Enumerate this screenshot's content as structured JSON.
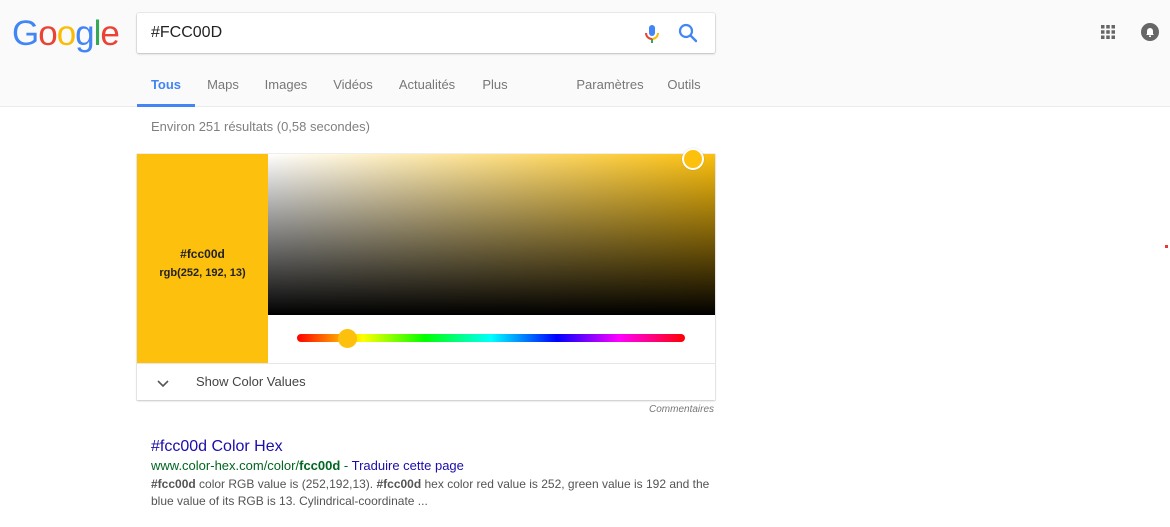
{
  "header": {
    "logo_letters": [
      {
        "char": "G",
        "color": "#4285f4"
      },
      {
        "char": "o",
        "color": "#ea4335"
      },
      {
        "char": "o",
        "color": "#fbbc05"
      },
      {
        "char": "g",
        "color": "#4285f4"
      },
      {
        "char": "l",
        "color": "#34a853"
      },
      {
        "char": "e",
        "color": "#ea4335"
      }
    ],
    "search_value": "#FCC00D",
    "mic_icon": "microphone-icon",
    "search_icon": "search-icon",
    "apps_icon": "apps-grid-icon",
    "notifications_icon": "bell-icon"
  },
  "tabs": [
    {
      "label": "Tous",
      "active": true
    },
    {
      "label": "Maps"
    },
    {
      "label": "Images"
    },
    {
      "label": "Vidéos"
    },
    {
      "label": "Actualités"
    },
    {
      "label": "Plus"
    },
    {
      "label": "Paramètres"
    },
    {
      "label": "Outils"
    }
  ],
  "stats": "Environ 251 résultats (0,58 secondes)",
  "color_picker": {
    "hex": "#fcc00d",
    "rgb": "rgb(252, 192, 13)",
    "swatch_color": "#fcc00d",
    "saturation": 1.0,
    "value": 0.99,
    "hue_degrees": 45,
    "show_values_label": "Show Color Values",
    "feedback": "Commentaires"
  },
  "result": {
    "title": "#fcc00d Color Hex",
    "url_prefix": "www.color-hex.com/color/",
    "url_bold": "fcc00d",
    "url_sep": " - ",
    "translate": "Traduire cette page",
    "snippet_parts": [
      {
        "text": "#fcc00d",
        "bold": true
      },
      {
        "text": " color RGB value is (252,192,13). ",
        "bold": false
      },
      {
        "text": "#fcc00d",
        "bold": true
      },
      {
        "text": " hex color red value is 252, green value is 192 and the blue value of its RGB is 13. Cylindrical-coordinate ...",
        "bold": false
      }
    ]
  }
}
